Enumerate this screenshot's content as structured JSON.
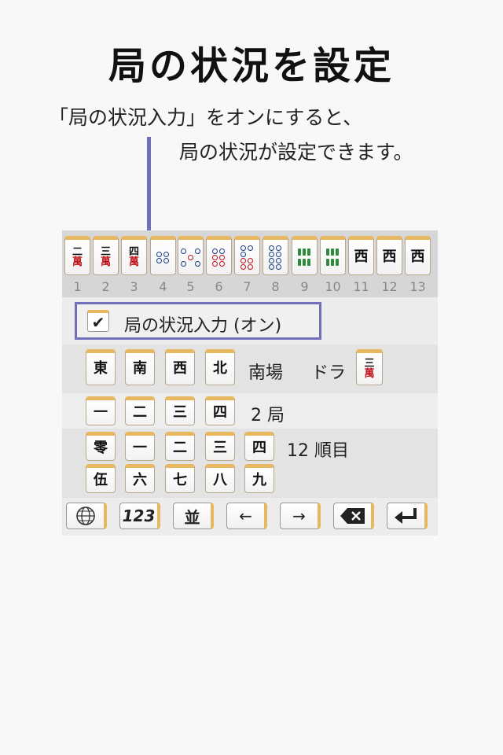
{
  "title": "局の状況を設定",
  "description": {
    "line1": "「局の状況入力」をオンにすると、",
    "line2": "局の状況が設定できます。"
  },
  "hand": {
    "numbers": [
      "1",
      "2",
      "3",
      "4",
      "5",
      "6",
      "7",
      "8",
      "9",
      "10",
      "11",
      "12",
      "13"
    ],
    "tiles": [
      {
        "kind": "man",
        "num": "二",
        "mark": "萬"
      },
      {
        "kind": "man",
        "num": "三",
        "mark": "萬"
      },
      {
        "kind": "man",
        "num": "四",
        "mark": "萬"
      },
      {
        "kind": "pin",
        "count": 4
      },
      {
        "kind": "pin",
        "count": 5
      },
      {
        "kind": "pin",
        "count": 6
      },
      {
        "kind": "pin",
        "count": 7
      },
      {
        "kind": "pin",
        "count": 8
      },
      {
        "kind": "sou",
        "count": 6
      },
      {
        "kind": "sou",
        "count": 6
      },
      {
        "kind": "honor",
        "char": "西"
      },
      {
        "kind": "honor",
        "char": "西"
      },
      {
        "kind": "honor",
        "char": "西"
      }
    ]
  },
  "toggle": {
    "checkmark": "✔",
    "label": "局の状況入力 (オン)"
  },
  "winds": {
    "tiles": [
      "東",
      "南",
      "西",
      "北"
    ],
    "round_label": "南場",
    "dora_label": "ドラ",
    "dora_tile": {
      "num": "三",
      "mark": "萬"
    }
  },
  "kyoku": {
    "tiles": [
      "一",
      "二",
      "三",
      "四"
    ],
    "label": "2 局"
  },
  "junme": {
    "row1": [
      "零",
      "一",
      "二",
      "三",
      "四"
    ],
    "row2": [
      "伍",
      "六",
      "七",
      "八",
      "九"
    ],
    "label": "12 順目"
  },
  "toolbar": {
    "numbers_label": "123",
    "kanji_label": "並",
    "left_label": "←",
    "right_label": "→"
  }
}
